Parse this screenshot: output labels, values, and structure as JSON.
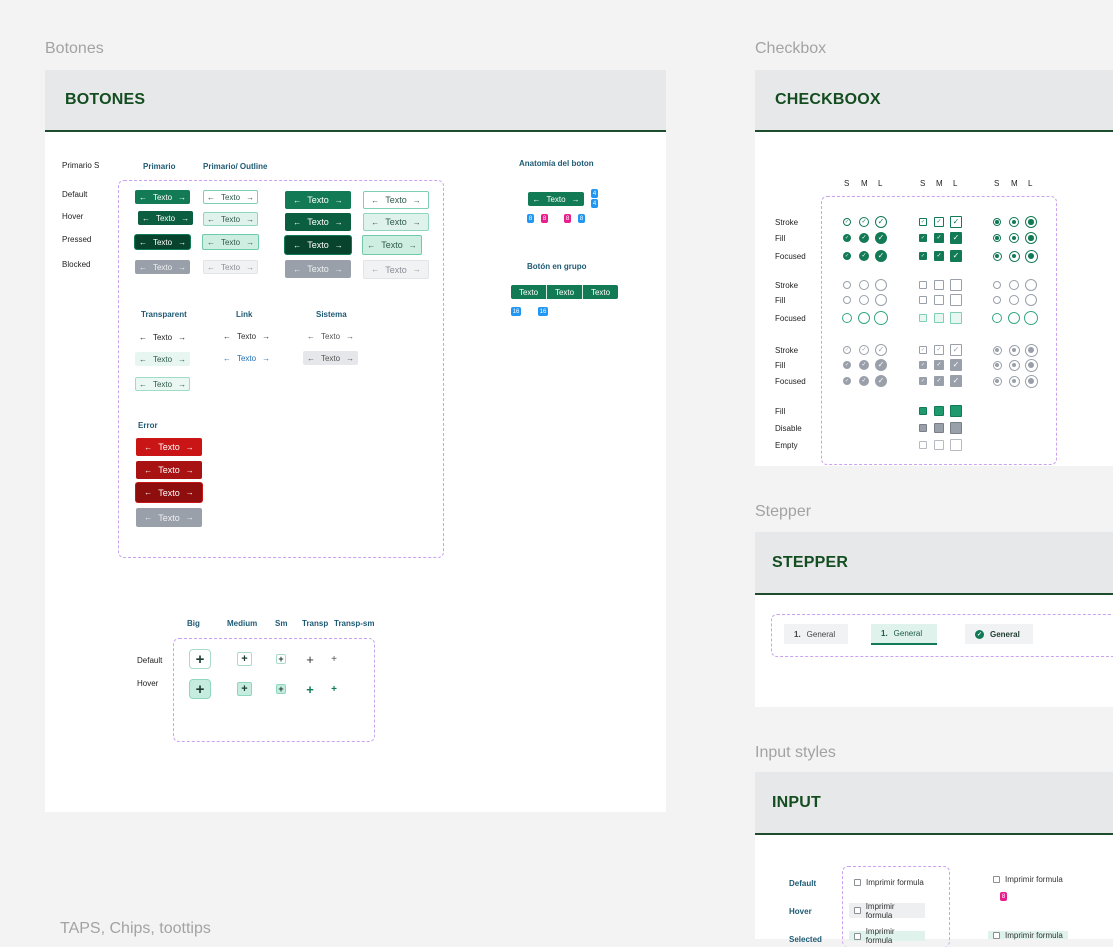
{
  "frames": {
    "botones_label": "Botones",
    "checkbox_label": "Checkbox",
    "stepper_label": "Stepper",
    "input_label": "Input styles",
    "taps_label": "TAPS, Chips, toottips"
  },
  "botones": {
    "title": "BOTONES",
    "primario_s": "Primario S",
    "col_primario": "Primario",
    "col_outline": "Primario/ Outline",
    "states": [
      "Default",
      "Hover",
      "Pressed",
      "Blocked"
    ],
    "button_text": "Texto",
    "col_transparent": "Transparent",
    "col_link": "Link",
    "col_sistema": "Sistema",
    "col_error": "Error",
    "anatomia_title": "Anatomía del boton",
    "grupo_title": "Botón en grupo",
    "anatomy_tags": [
      "4",
      "4",
      "8",
      "8",
      "8",
      "8"
    ],
    "group_tags": [
      "16",
      "16"
    ],
    "group_buttons": [
      "Texto",
      "Texto",
      "Texto"
    ],
    "icon_cols": [
      "Big",
      "Medium",
      "Sm",
      "Transp",
      "Transp-sm"
    ],
    "icon_states": [
      "Default",
      "Hover"
    ],
    "arrow_left": "←",
    "arrow_right": "→",
    "plus": "+"
  },
  "checkbox": {
    "title": "CHECKBOOX",
    "size_headers": [
      "S",
      "M",
      "L",
      "S",
      "M",
      "L",
      "S",
      "M",
      "L"
    ],
    "group1": [
      "Stroke",
      "Fill",
      "Focused"
    ],
    "group2": [
      "Stroke",
      "Fill",
      "Focused"
    ],
    "group3": [
      "Stroke",
      "Fill",
      "Focused"
    ],
    "group4": [
      "Fill",
      "Disable",
      "Empty"
    ],
    "check": "✓"
  },
  "stepper": {
    "title": "STEPPER",
    "steps": [
      {
        "num": "1.",
        "label": "General"
      },
      {
        "num": "1.",
        "label": "General"
      },
      {
        "num": "",
        "label": "General"
      }
    ],
    "check": "✓"
  },
  "input": {
    "title": "INPUT",
    "states": [
      "Default",
      "Hover",
      "Selected"
    ],
    "field_text": "Imprimir formula",
    "tag": "8"
  },
  "colors": {
    "primary": "#127a55",
    "dark_green": "#134d20",
    "error": "#c91515",
    "blocked": "#9aa0aa",
    "dash": "#c9a3f0",
    "tag_blue": "#2196f3",
    "tag_pink": "#e91e8c"
  }
}
